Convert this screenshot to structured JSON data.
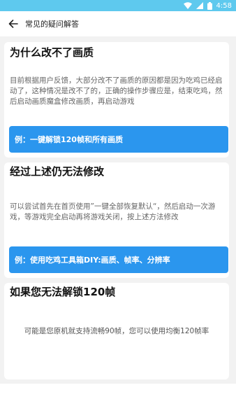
{
  "status_bar": {
    "time": "4:58"
  },
  "app_bar": {
    "title": "常见的疑问解答"
  },
  "cards": [
    {
      "title": "为什么改不了画质",
      "body": "目前根据用户反馈，大部分改不了画质的原因都是因为吃鸡已经启动了，这种情况是改不了的，正确的操作步骤应是，结束吃鸡，然后启动画质魔盒修改画质，再启动游戏",
      "button": "例：一键解锁120帧和所有画质"
    },
    {
      "title": "经过上述仍无法修改",
      "body": "可以尝试首先在首页使用”一键全部恢复默认“，然后启动一次游戏，等游戏完全启动再将游戏关闭，按上述方法修改",
      "button": "例：使用吃鸡工具箱DIY:画质、帧率、分辨率"
    },
    {
      "title": "如果您无法解锁120帧",
      "body": "可能是您原机就支持流畅90帧，您可以使用均衡120帧率"
    }
  ]
}
